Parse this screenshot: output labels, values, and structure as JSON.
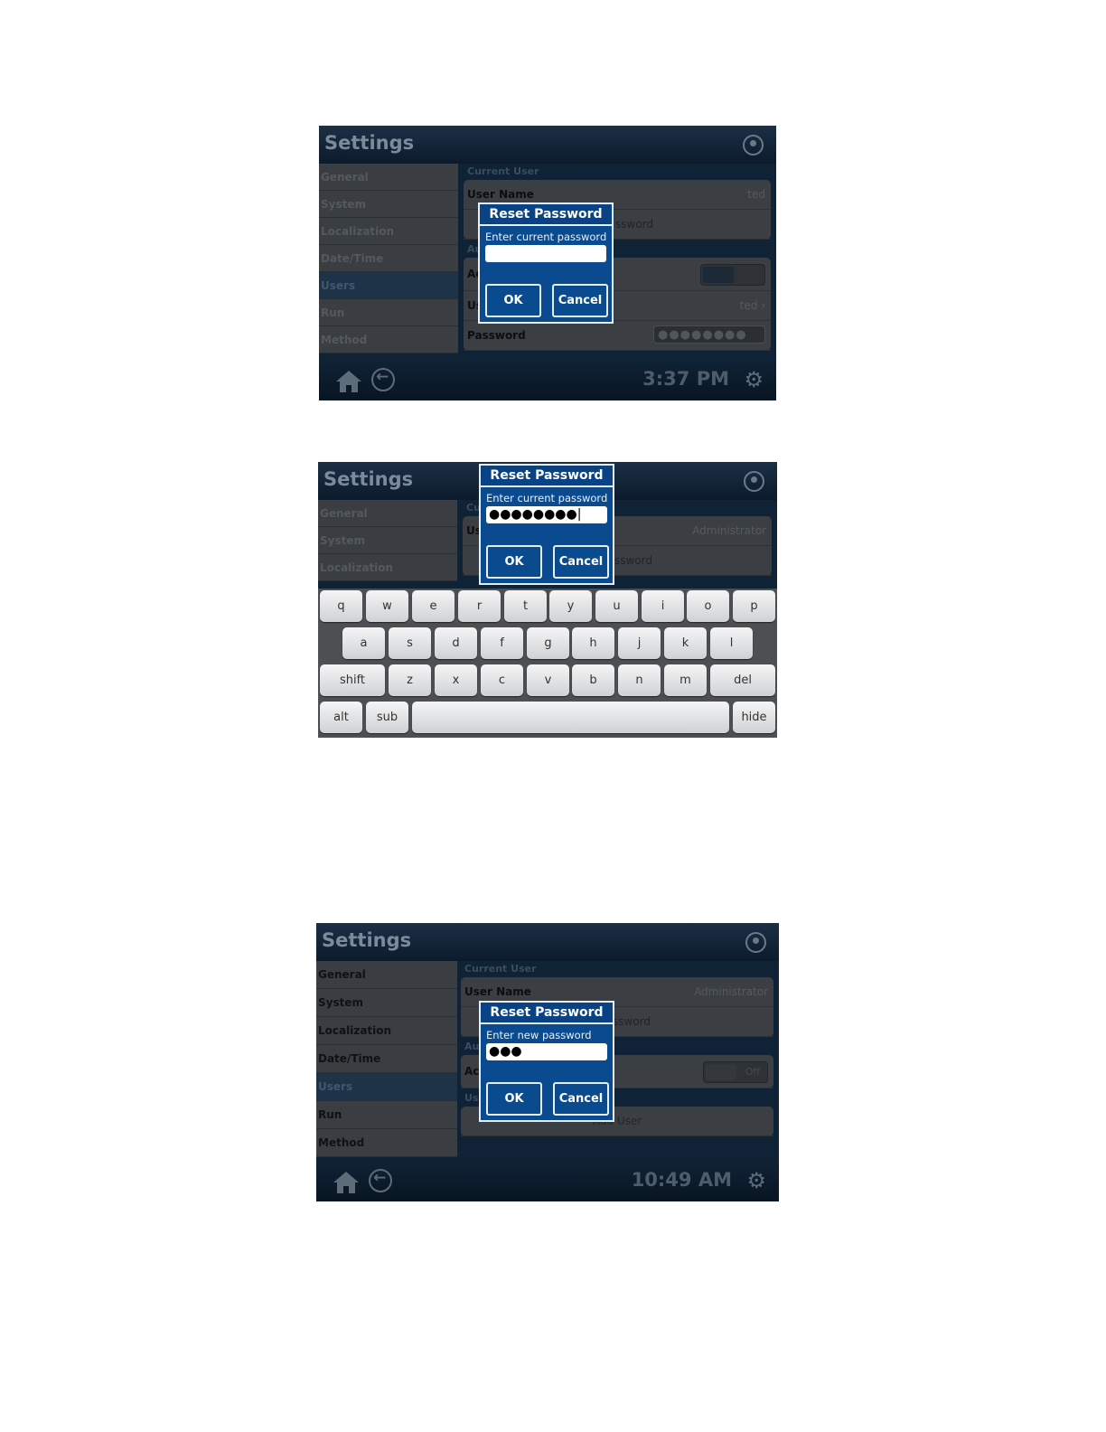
{
  "screen1": {
    "title": "Settings",
    "sidebar": [
      "General",
      "System",
      "Localization",
      "Date/Time",
      "Users",
      "Run",
      "Method"
    ],
    "active_item": "Users",
    "section_current_user": "Current User",
    "user_name_label": "User Name",
    "user_name_value": "ted",
    "reset_password_row": "Reset Password",
    "password_overlap": "ssword",
    "section_auth_clip": "Au",
    "row_ac_clip": "Ac",
    "row_us_clip": "Us",
    "user_value": "ted",
    "password_label": "Password",
    "password_value": "●●●●●●●●",
    "time": "3:37 PM",
    "dialog": {
      "title": "Reset Password",
      "prompt": "Enter current password",
      "input_value": "",
      "ok": "OK",
      "cancel": "Cancel"
    }
  },
  "screen2": {
    "title": "Settings",
    "sidebar": [
      "General",
      "System",
      "Localization"
    ],
    "section_clip": "Cu",
    "user_name_clip": "Us",
    "user_name_value": "Administrator",
    "password_overlap": "ssword",
    "dialog": {
      "title": "Reset Password",
      "prompt": "Enter current password",
      "input_value": "●●●●●●●●|",
      "ok": "OK",
      "cancel": "Cancel"
    },
    "keyboard": {
      "row1": [
        "q",
        "w",
        "e",
        "r",
        "t",
        "y",
        "u",
        "i",
        "o",
        "p"
      ],
      "row2": [
        "a",
        "s",
        "d",
        "f",
        "g",
        "h",
        "j",
        "k",
        "l"
      ],
      "row3": [
        "shift",
        "z",
        "x",
        "c",
        "v",
        "b",
        "n",
        "m",
        "del"
      ],
      "row4": [
        "alt",
        "sub",
        "",
        "hide"
      ]
    }
  },
  "screen3": {
    "title": "Settings",
    "sidebar": [
      "General",
      "System",
      "Localization",
      "Date/Time",
      "Users",
      "Run",
      "Method"
    ],
    "active_item": "Users",
    "section_current_user": "Current User",
    "user_name_label": "User Name",
    "user_name_value": "Administrator",
    "password_overlap": "ssword",
    "section_auth_clip": "Au",
    "row_ac_clip": "Ac",
    "toggle_label": "Off",
    "row_us_clip": "Us",
    "add_user": "Add User",
    "time": "10:49 AM",
    "dialog": {
      "title": "Reset Password",
      "prompt": "Enter new password",
      "input_value": "●●●",
      "ok": "OK",
      "cancel": "Cancel"
    }
  }
}
